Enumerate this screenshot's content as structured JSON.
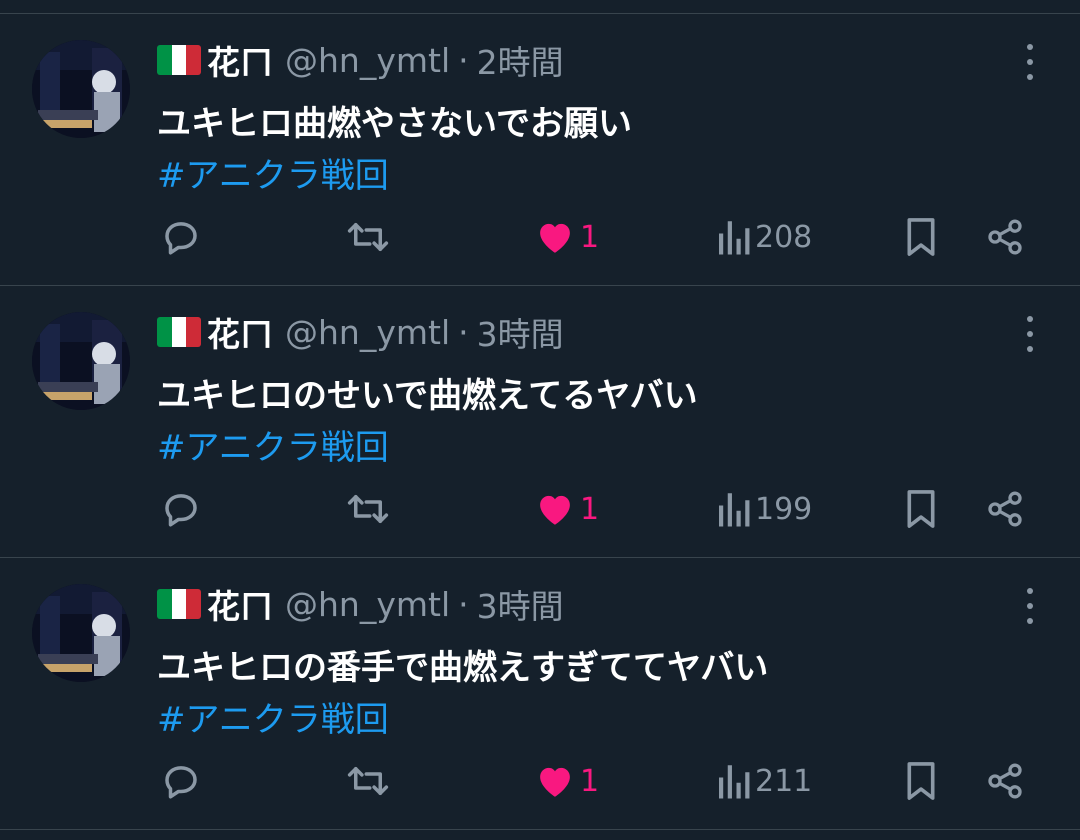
{
  "colors": {
    "background": "#15202b",
    "divider": "#38444d",
    "text_primary": "#ffffff",
    "text_secondary": "#8b98a5",
    "hashtag": "#1d9bf0",
    "like_active": "#f91880"
  },
  "icons": {
    "reply": "speech-bubble-icon",
    "retweet": "retweet-arrows-icon",
    "like": "heart-filled-icon",
    "views": "bar-chart-icon",
    "bookmark": "bookmark-icon",
    "share": "share-nodes-icon",
    "more": "vertical-ellipsis-icon",
    "flag": "italy-flag-icon"
  },
  "tweets": [
    {
      "author_name": "花ㄇ",
      "handle": "@hn_ymtl",
      "separator": "·",
      "time": "2時間",
      "text": "ユキヒロ曲燃やさないでお願い",
      "hashtag": "#アニクラ戦回",
      "likes": "1",
      "views": "208"
    },
    {
      "author_name": "花ㄇ",
      "handle": "@hn_ymtl",
      "separator": "·",
      "time": "3時間",
      "text": "ユキヒロのせいで曲燃えてるヤバい",
      "hashtag": "#アニクラ戦回",
      "likes": "1",
      "views": "199"
    },
    {
      "author_name": "花ㄇ",
      "handle": "@hn_ymtl",
      "separator": "·",
      "time": "3時間",
      "text": "ユキヒロの番手で曲燃えすぎててヤバい",
      "hashtag": "#アニクラ戦回",
      "likes": "1",
      "views": "211"
    }
  ]
}
